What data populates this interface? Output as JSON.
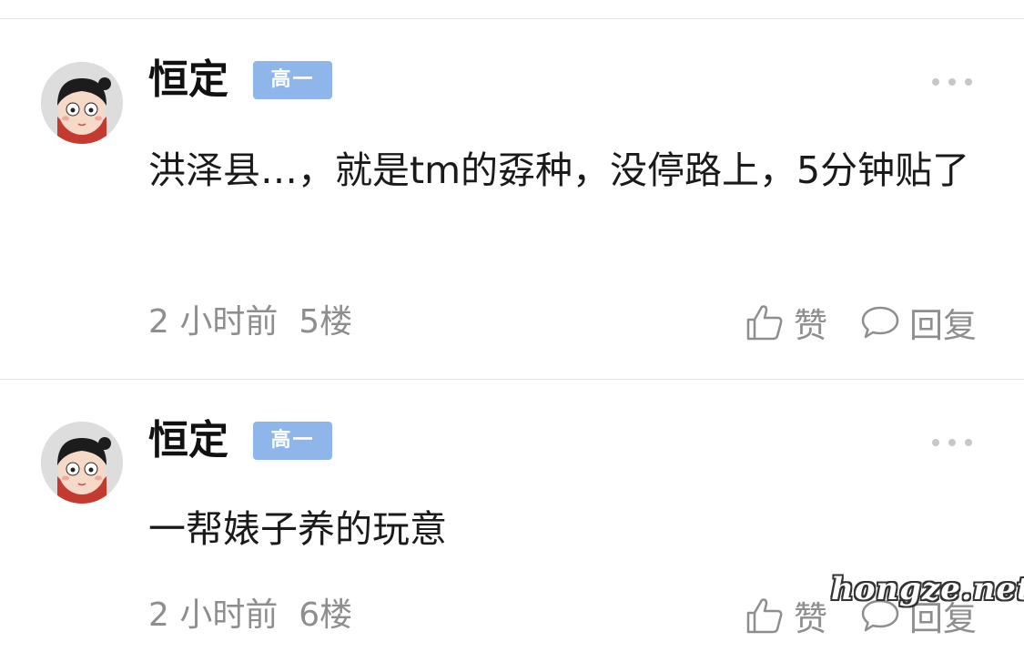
{
  "posts": [
    {
      "username": "恒定",
      "badge": "高一",
      "content": "洪泽县…，就是tm的孬种，没停路上，5分钟贴了",
      "time": "2 小时前",
      "floor": "5楼",
      "like_label": "赞",
      "reply_label": "回复"
    },
    {
      "username": "恒定",
      "badge": "高一",
      "content": "一帮婊子养的玩意",
      "time": "2 小时前",
      "floor": "6楼",
      "like_label": "赞",
      "reply_label": "回复"
    }
  ],
  "watermark": "hongze.net",
  "icons": {
    "more": "more-dots-icon",
    "like": "thumbs-up-icon",
    "reply": "comment-bubble-icon"
  },
  "colors": {
    "badge_bg": "#8fb6ea",
    "meta_text": "#8e8e8e",
    "divider": "#e3e3e3"
  }
}
